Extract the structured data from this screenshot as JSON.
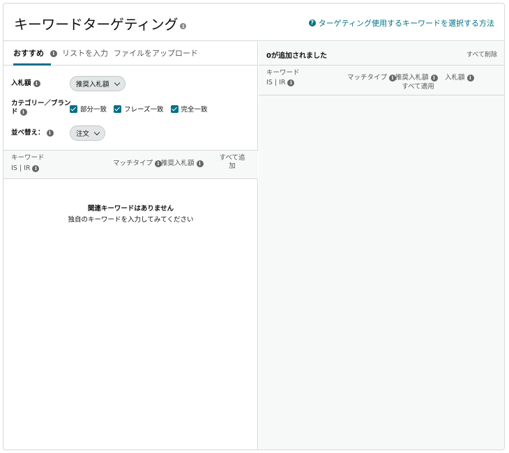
{
  "header": {
    "title": "キーワードターゲティング",
    "help_link": "ターゲティング使用するキーワードを選択する方法"
  },
  "tabs": [
    {
      "label": "おすすめ",
      "active": true
    },
    {
      "label": "リストを入力",
      "active": false
    },
    {
      "label": "ファイルをアップロード",
      "active": false
    }
  ],
  "filters": {
    "bid_label": "入札額",
    "bid_value": "推奨入札額",
    "category_label": "カテゴリー／ブランド",
    "match_types": [
      "部分一致",
      "フレーズ一致",
      "完全一致"
    ],
    "sort_label": "並べ替え：",
    "sort_value": "注文"
  },
  "left_table": {
    "col_keyword": "キーワード",
    "col_is_ir": "IS | IR",
    "col_match_type": "マッチタイプ",
    "col_suggested_bid": "推奨入札額",
    "col_add_all": "すべて追加",
    "empty_title": "関連キーワードはありません",
    "empty_sub": "独自のキーワードを入力してみてください"
  },
  "right_panel": {
    "added_count": "0が追加されました",
    "remove_all": "すべて削除",
    "col_keyword": "キーワード",
    "col_is_ir": "IS | IR",
    "col_match_type": "マッチタイプ",
    "col_suggested_bid": "推奨入札額",
    "col_apply_all": "すべて適用",
    "col_bid": "入札額"
  },
  "colors": {
    "accent": "#007185",
    "border": "#d5d9d9",
    "muted": "#565959"
  }
}
